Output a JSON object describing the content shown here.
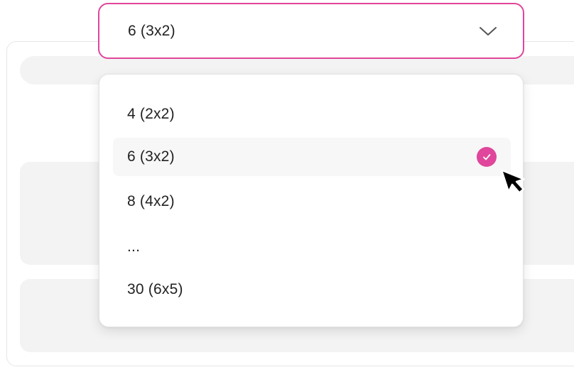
{
  "select": {
    "value": "6 (3x2)",
    "icon": "chevron-down-icon"
  },
  "menu": {
    "options": [
      {
        "label": "4 (2x2)",
        "selected": false
      },
      {
        "label": "6 (3x2)",
        "selected": true
      },
      {
        "label": "8 (4x2)",
        "selected": false
      },
      {
        "label": "...",
        "selected": false
      },
      {
        "label": "30 (6x5)",
        "selected": false
      }
    ],
    "selected_icon": "check-icon"
  },
  "colors": {
    "accent": "#e0469b",
    "text": "#222222",
    "selected_row_bg": "#f7f7f7",
    "border": "#e3e3e3"
  },
  "cursor_icon": "mouse-pointer-icon"
}
